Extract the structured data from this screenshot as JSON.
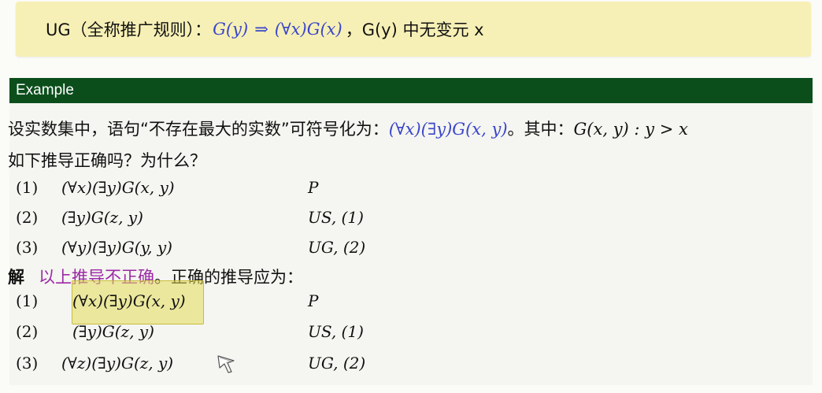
{
  "rule": {
    "prefix": "UG（全称推广规则）：",
    "premise": "G(y)",
    "arrow": "⇒",
    "conclusion": "(∀x)G(x)",
    "suffix": "，G(y) 中无变元 x"
  },
  "example": {
    "header": "Example",
    "statement_prefix": "设实数集中，语句“不存在最大的实数”可符号化为：",
    "statement_formula": "(∀x)(∃y)G(x, y)",
    "statement_mid": "。其中：",
    "statement_def": "G(x, y) : y > x",
    "question": "如下推导正确吗？为什么？",
    "wrong_derivation": [
      {
        "num": "(1)",
        "formula": "(∀x)(∃y)G(x, y)",
        "reason": "P"
      },
      {
        "num": "(2)",
        "formula": "(∃y)G(z, y)",
        "reason": "US, (1)"
      },
      {
        "num": "(3)",
        "formula": "(∀y)(∃y)G(y, y)",
        "reason": "UG, (2)"
      }
    ],
    "solution_label": "解",
    "solution_highlight": "以上推导不正确",
    "solution_rest": "。正确的推导应为：",
    "correct_derivation": [
      {
        "num": "(1)",
        "formula": "(∀x)(∃y)G(x, y)",
        "reason": "P"
      },
      {
        "num": "(2)",
        "formula": "(∃y)G(z, y)",
        "reason": "US, (1)"
      },
      {
        "num": "(3)",
        "formula": "(∀z)(∃y)G(z, y)",
        "reason": "UG, (2)"
      }
    ]
  },
  "colors": {
    "rule_bg": "#f7f0b6",
    "header_bg": "#0b4e1c",
    "formula_blue": "#3a46c9",
    "highlight_purple": "#9b2aa6",
    "marker_yellow": "#e2db58"
  },
  "icons": {
    "cursor": "pointer-cursor-icon"
  }
}
